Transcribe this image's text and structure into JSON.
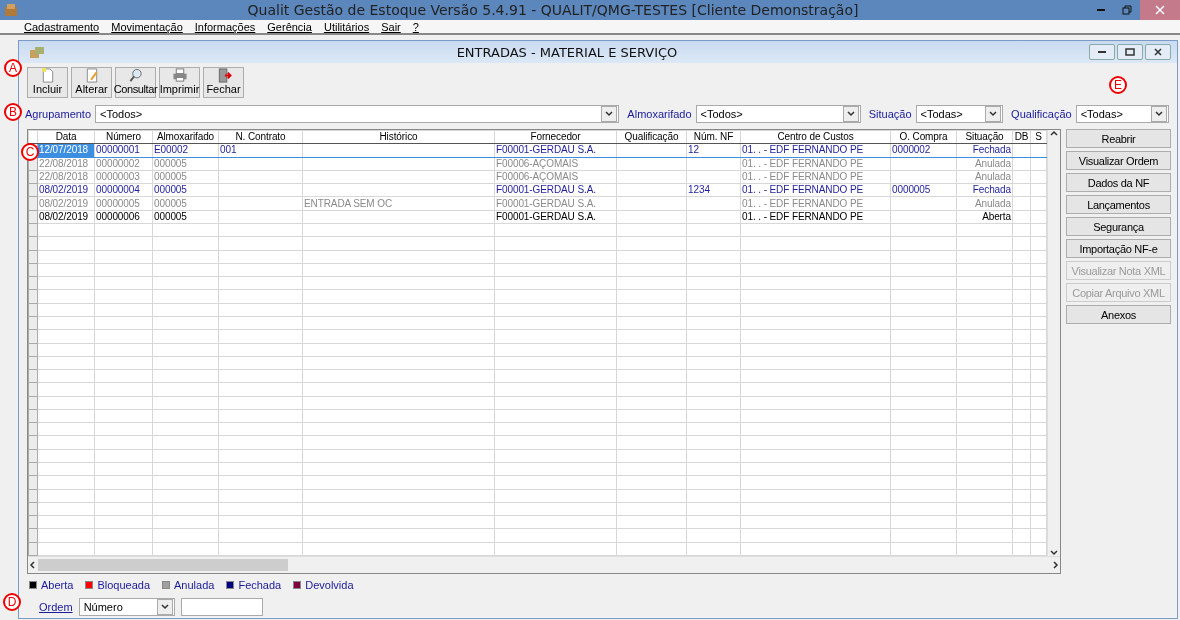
{
  "app_window": {
    "title": "Qualit Gestão de Estoque Versão 5.4.91 - QUALIT/QMG-TESTES [Cliente Demonstração]"
  },
  "menu": [
    "Cadastramento",
    "Movimentação",
    "Informações",
    "Gerência",
    "Utilitários",
    "Sair",
    "?"
  ],
  "child_window": {
    "title": "ENTRADAS - MATERIAL E SERVIÇO"
  },
  "toolbar": [
    {
      "label": "Incluir",
      "kind": "new"
    },
    {
      "label": "Alterar",
      "kind": "edit"
    },
    {
      "label": "Consultar",
      "kind": "search"
    },
    {
      "label": "Imprimir",
      "kind": "print"
    },
    {
      "label": "Fechar",
      "kind": "exit"
    }
  ],
  "filters": [
    {
      "label": "Agrupamento",
      "value": "<Todos>"
    },
    {
      "label": "Almoxarifado",
      "value": "<Todos>"
    },
    {
      "label": "Situação",
      "value": "<Todas>"
    },
    {
      "label": "Qualificação",
      "value": "<Todas>"
    }
  ],
  "table": {
    "columns": [
      "Data",
      "Número",
      "Almoxarifado",
      "N. Contrato",
      "Histórico",
      "Fornecedor",
      "Qualificação",
      "Núm. NF",
      "Centro de Custos",
      "O. Compra",
      "Situação",
      "DB",
      "S"
    ],
    "rows": [
      {
        "color": "#1f1f9a",
        "selected": true,
        "cells": [
          "12/07/2018",
          "00000001",
          "E00002",
          "001",
          "",
          "F00001-GERDAU S.A.",
          "",
          "12",
          "01.   .   - EDF FERNANDO PE",
          "0000002",
          "Fechada",
          "",
          ""
        ]
      },
      {
        "color": "#8a8a8a",
        "selected": false,
        "cells": [
          "22/08/2018",
          "00000002",
          "000005",
          "",
          "",
          "F00006-AÇOMAIS",
          "",
          "",
          "01.   .   - EDF FERNANDO PE",
          "",
          "Anulada",
          "",
          ""
        ]
      },
      {
        "color": "#8a8a8a",
        "selected": false,
        "cells": [
          "22/08/2018",
          "00000003",
          "000005",
          "",
          "",
          "F00006-AÇOMAIS",
          "",
          "",
          "01.   .   - EDF FERNANDO PE",
          "",
          "Anulada",
          "",
          ""
        ]
      },
      {
        "color": "#1f1f9a",
        "selected": false,
        "cells": [
          "08/02/2019",
          "00000004",
          "000005",
          "",
          "",
          "F00001-GERDAU S.A.",
          "",
          "1234",
          "01.   .   - EDF FERNANDO PE",
          "0000005",
          "Fechada",
          "",
          ""
        ]
      },
      {
        "color": "#8a8a8a",
        "selected": false,
        "cells": [
          "08/02/2019",
          "00000005",
          "000005",
          "",
          "ENTRADA SEM OC",
          "F00001-GERDAU S.A.",
          "",
          "",
          "01.   .   - EDF FERNANDO PE",
          "",
          "Anulada",
          "",
          ""
        ]
      },
      {
        "color": "#000000",
        "selected": false,
        "cells": [
          "08/02/2019",
          "00000006",
          "000005",
          "",
          "",
          "F00001-GERDAU S.A.",
          "",
          "",
          "01.   .   - EDF FERNANDO PE",
          "",
          "Aberta",
          "",
          ""
        ]
      }
    ]
  },
  "side_buttons": [
    {
      "label": "Reabrir",
      "disabled": false
    },
    {
      "label": "Visualizar Ordem",
      "disabled": false
    },
    {
      "label": "Dados da NF",
      "disabled": false
    },
    {
      "label": "Lançamentos",
      "disabled": false
    },
    {
      "label": "Segurança",
      "disabled": false
    },
    {
      "label": "Importação NF-e",
      "disabled": false
    },
    {
      "label": "Visualizar Nota XML",
      "disabled": true
    },
    {
      "label": "Copiar Arquivo XML",
      "disabled": true
    },
    {
      "label": "Anexos",
      "disabled": false
    }
  ],
  "legend": [
    {
      "label": "Aberta",
      "color": "#000000"
    },
    {
      "label": "Bloqueada",
      "color": "#ff0000"
    },
    {
      "label": "Anulada",
      "color": "#a0a0a0"
    },
    {
      "label": "Fechada",
      "color": "#000080"
    },
    {
      "label": "Devolvida",
      "color": "#800040"
    }
  ],
  "order": {
    "label": "Ordem",
    "value": "Número"
  },
  "callouts": [
    "A",
    "B",
    "C",
    "D",
    "E"
  ]
}
